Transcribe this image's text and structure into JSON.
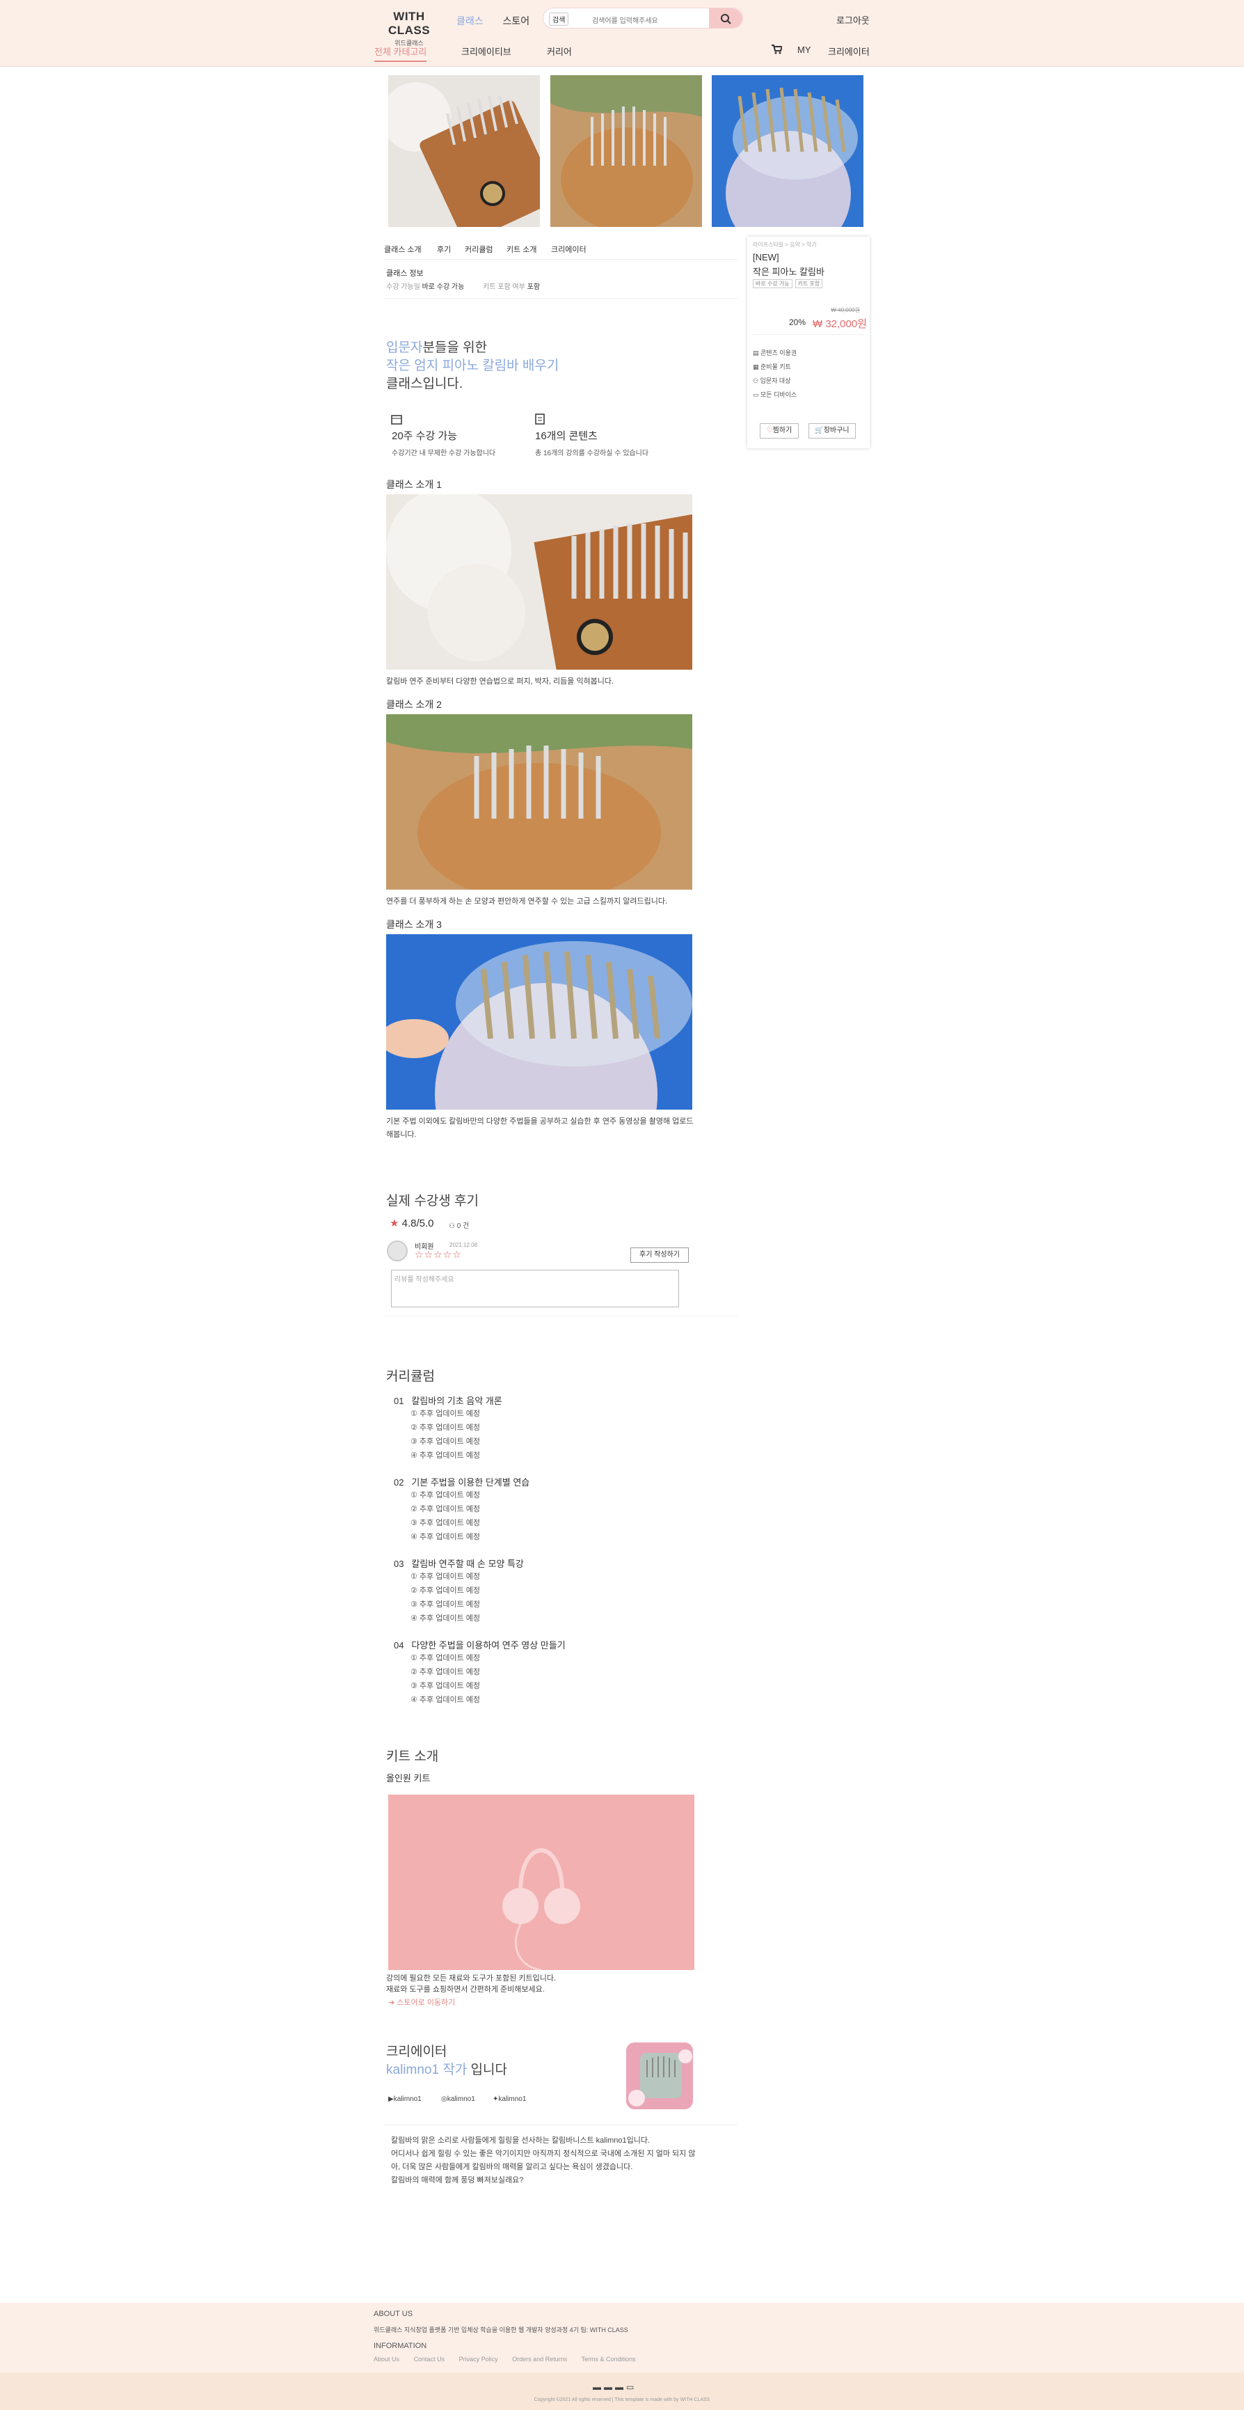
{
  "header": {
    "logo_main": "WITH CLASS",
    "logo_sub": "위드클래스",
    "nav_class": "클래스",
    "nav_store": "스토어",
    "search_select": "검색",
    "search_placeholder": "검색어를 입력해주세요",
    "logout": "로그아웃",
    "all_category": "전체 카테고리",
    "creative": "크리에이티브",
    "career": "커리어",
    "my": "MY",
    "creator": "크리에이터"
  },
  "tabs": [
    "클래스 소개",
    "후기",
    "커리큘럼",
    "키트 소개",
    "크리에이터"
  ],
  "class_info": {
    "title": "클래스 정보",
    "k1": "수강 가능일",
    "v1": "바로 수강 가능",
    "k2": "키트 포함 여부",
    "v2": "포함"
  },
  "sidebar": {
    "category": "라이프스타일 > 음악 > 악기",
    "title_line1": "[NEW]",
    "title_line2": "작은 피아노 칼림바",
    "tag1": "바로 수강 가능",
    "tag2": "키트 포함",
    "old_price": "₩ 40,000원",
    "percent": "20%",
    "price": "₩ 32,000원",
    "features": [
      "콘텐츠 이용권",
      "준비물 키트",
      "입문자 대상",
      "모든 디바이스"
    ],
    "like": "찜하기",
    "cart": "장바구니"
  },
  "intro": {
    "l1a": "입문자",
    "l1b": "분들을 위한",
    "l2": "작은 엄지 피아노 칼림바 배우기",
    "l3": "클래스입니다."
  },
  "stats": [
    {
      "title": "20주 수강 가능",
      "desc": "수강기간 내 무제한 수강 가능합니다"
    },
    {
      "title": "16개의 콘텐츠",
      "desc": "총 16개의 강의를 수강하실 수 있습니다"
    }
  ],
  "sections": [
    {
      "title": "클래스 소개 1",
      "caption": "칼림바 연주 준비부터 다양한 연습법으로 퍼지, 박자, 리듬을 익혀봅니다."
    },
    {
      "title": "클래스 소개 2",
      "caption": "연주를 더 풍부하게 하는 손 모양과 편안하게 연주할 수 있는 고급 스킬까지 알려드립니다."
    },
    {
      "title": "클래스 소개 3",
      "caption": "기본 주법 이외에도 칼림바만의 다양한 주법들을 공부하고 실습한 후 연주 동영상을 촬영해 업로드 해봅니다."
    }
  ],
  "review": {
    "title": "실제 수강생 후기",
    "score": "4.8/5.0",
    "count": "0 건",
    "user": "비회원",
    "date": "2021.12.08",
    "write_btn": "후기 작성하기",
    "placeholder": "리뷰를 작성해주세요"
  },
  "curriculum": {
    "title": "커리큘럼",
    "chapters": [
      {
        "num": "01",
        "title": "칼림바의 기초 음악 개론",
        "items": [
          "① 추후 업데이트 예정",
          "② 추후 업데이트 예정",
          "③ 추후 업데이트 예정",
          "④ 추후 업데이트 예정"
        ]
      },
      {
        "num": "02",
        "title": "기본 주법을 이용한 단계별 연습",
        "items": [
          "① 추후 업데이트 예정",
          "② 추후 업데이트 예정",
          "③ 추후 업데이트 예정",
          "④ 추후 업데이트 예정"
        ]
      },
      {
        "num": "03",
        "title": "칼림바 연주할 때 손 모양 특강",
        "items": [
          "① 추후 업데이트 예정",
          "② 추후 업데이트 예정",
          "③ 추후 업데이트 예정",
          "④ 추후 업데이트 예정"
        ]
      },
      {
        "num": "04",
        "title": "다양한 주법을 이용하여 연주 영상 만들기",
        "items": [
          "① 추후 업데이트 예정",
          "② 추후 업데이트 예정",
          "③ 추후 업데이트 예정",
          "④ 추후 업데이트 예정"
        ]
      }
    ]
  },
  "kit": {
    "title": "키트 소개",
    "sub": "올인원 키트",
    "desc1": "강의에 필요한 모든 재료와 도구가 포함된 키트입니다.",
    "desc2": "재료와 도구를 쇼핑하면서 간편하게 준비해보세요.",
    "link": "스토어로 이동하기"
  },
  "creator": {
    "title": "크리에이터",
    "name": "kalimno1 작가",
    "suffix": " 입니다",
    "sns": [
      "kalimno1",
      "kalimno1",
      "kalimno1"
    ],
    "bio": [
      "칼림바의 맑은 소리로 사람들에게 힐링을 선사하는 칼림바니스트 kalimno1입니다.",
      "어디서나 쉽게 힐링 수 있는 좋은 악기이지만 아직까지 정식적으로 국내에 소개된 지 얼마 되지 않아, 더욱 많은 사람들에게 칼림바의 매력을 알리고 싶다는 욕심이 생겼습니다.",
      "칼림바의 매력에 함께 풍덩 빠져보실래요?"
    ]
  },
  "footer": {
    "about_title": "ABOUT US",
    "about_text": "위드클래스 지식창업 플랫폼 기반 입체상 학습을 이용한 웹 개발자 양성과정 4기 팀: WITH CLASS",
    "info_title": "INFORMATION",
    "links": [
      "About Us",
      "Contact Us",
      "Privacy Policy",
      "Orders and Returns",
      "Terms & Conditions"
    ],
    "copyright": "Copyright ©2021 All rights reserved | This template is made with by WITH CLASS"
  }
}
